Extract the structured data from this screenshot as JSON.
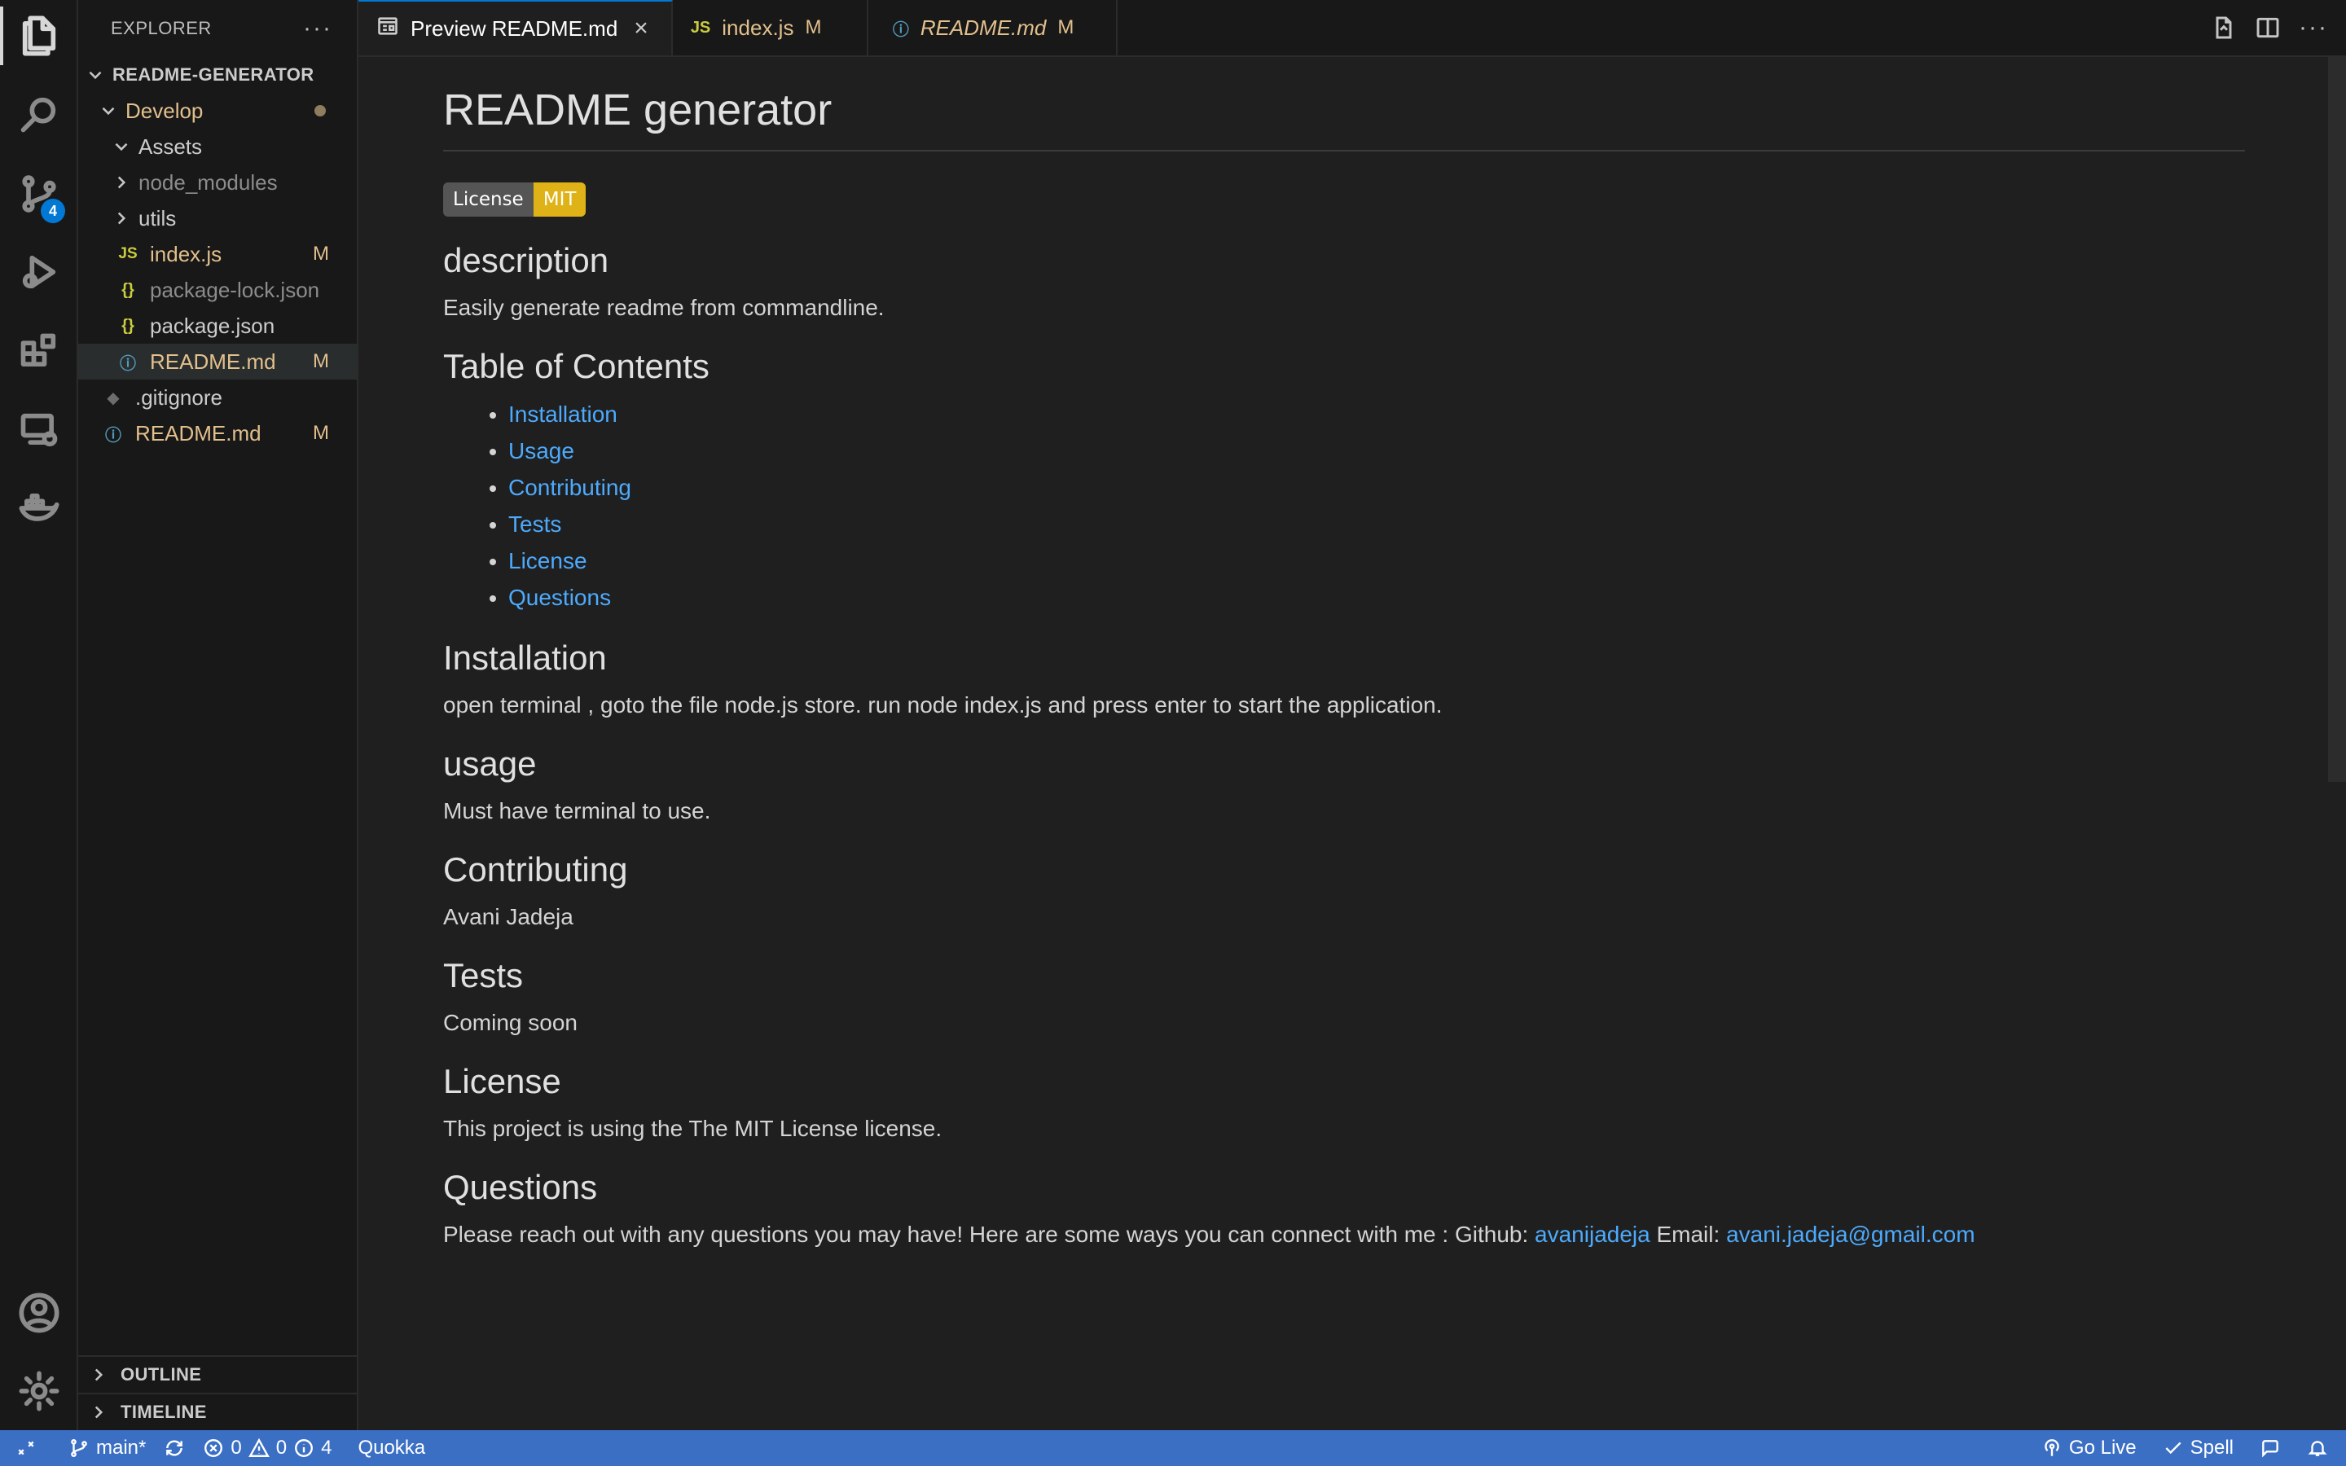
{
  "activity_bar": {
    "source_control_badge": "4"
  },
  "sidebar": {
    "title": "EXPLORER",
    "more": "···",
    "project": "README-GENERATOR",
    "tree": {
      "develop": "Develop",
      "assets": "Assets",
      "node_modules": "node_modules",
      "utils": "utils",
      "index_js": "index.js",
      "index_js_mark": "M",
      "package_lock": "package-lock.json",
      "package_json": "package.json",
      "readme_inner": "README.md",
      "readme_inner_mark": "M",
      "gitignore": ".gitignore",
      "readme_root": "README.md",
      "readme_root_mark": "M"
    },
    "outline": "OUTLINE",
    "timeline": "TIMELINE"
  },
  "tabs": [
    {
      "label": "Preview README.md",
      "close": "×"
    },
    {
      "label": "index.js",
      "mark": "M"
    },
    {
      "label": "README.md",
      "mark": "M"
    }
  ],
  "tab_actions": {
    "more": "···"
  },
  "preview": {
    "title": "README generator",
    "badge_left": "License",
    "badge_right": "MIT",
    "description_heading": "description",
    "description_text": "Easily generate readme from commandline.",
    "toc_heading": "Table of Contents",
    "toc": [
      "Installation",
      "Usage",
      "Contributing",
      "Tests",
      "License",
      "Questions"
    ],
    "installation_heading": "Installation",
    "installation_text": "open terminal , goto the file node.js store. run node index.js and press enter to start the application.",
    "usage_heading": "usage",
    "usage_text": "Must have terminal to use.",
    "contributing_heading": "Contributing",
    "contributing_text": "Avani Jadeja",
    "tests_heading": "Tests",
    "tests_text": "Coming soon",
    "license_heading": "License",
    "license_text": "This project is using the The MIT License license.",
    "questions_heading": "Questions",
    "questions_text": "Please reach out with any questions you may have! Here are some ways you can connect with me : Github:",
    "github_link": "avanijadeja",
    "email_label": "Email:",
    "email_link": "avani.jadeja@gmail.com"
  },
  "status_bar": {
    "branch": "main*",
    "errors": "0",
    "warnings": "0",
    "infos": "4",
    "quokka": "Quokka",
    "go_live": "Go Live",
    "spell": "Spell"
  }
}
